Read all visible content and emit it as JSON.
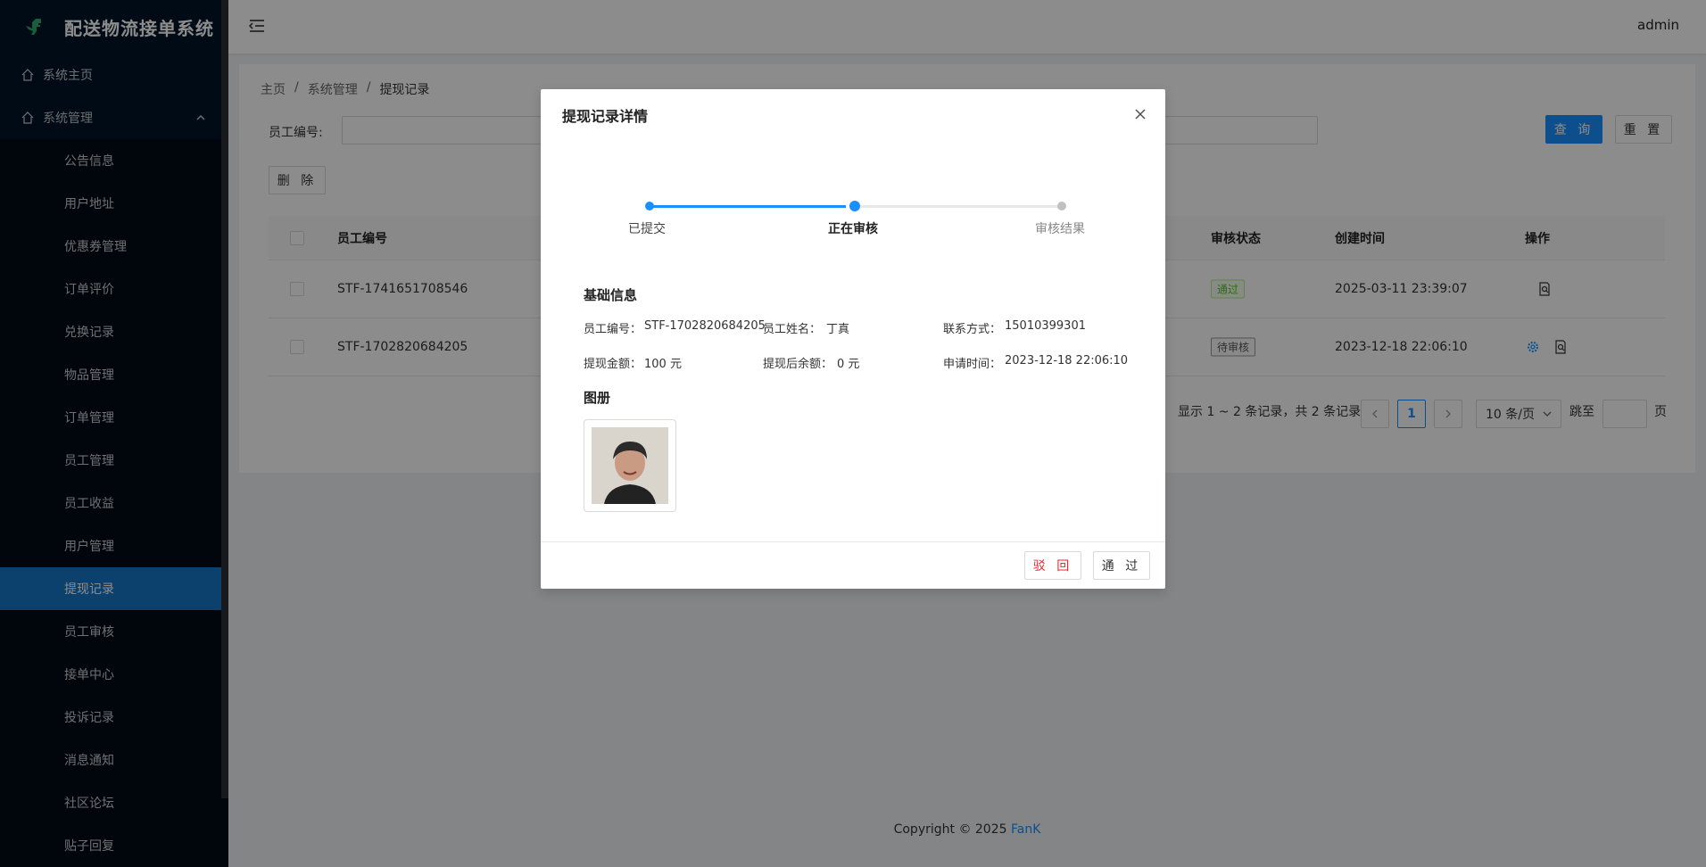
{
  "app": {
    "title": "配送物流接单系统",
    "user": "admin"
  },
  "sidebar": {
    "home": "系统主页",
    "group": "系统管理",
    "items": [
      {
        "label": "公告信息"
      },
      {
        "label": "用户地址"
      },
      {
        "label": "优惠券管理"
      },
      {
        "label": "订单评价"
      },
      {
        "label": "兑换记录"
      },
      {
        "label": "物品管理"
      },
      {
        "label": "订单管理"
      },
      {
        "label": "员工管理"
      },
      {
        "label": "员工收益"
      },
      {
        "label": "用户管理"
      },
      {
        "label": "提现记录",
        "active": true
      },
      {
        "label": "员工审核"
      },
      {
        "label": "接单中心"
      },
      {
        "label": "投诉记录"
      },
      {
        "label": "消息通知"
      },
      {
        "label": "社区论坛"
      },
      {
        "label": "贴子回复"
      }
    ]
  },
  "breadcrumb": [
    "主页",
    "系统管理",
    "提现记录"
  ],
  "search": {
    "label": "员工编号:",
    "value": "",
    "query_btn": "查 询",
    "reset_btn": "重 置"
  },
  "toolbar": {
    "delete_btn": "删 除"
  },
  "table": {
    "headers": {
      "staff_no": "员工编号",
      "status": "审核状态",
      "created": "创建时间",
      "ops": "操作"
    },
    "rows": [
      {
        "staff_no": "STF-1741651708546",
        "status": "通过",
        "created": "2025-03-11 23:39:07"
      },
      {
        "staff_no": "STF-1702820684205",
        "status": "待审核",
        "created": "2023-12-18 22:06:10"
      }
    ]
  },
  "pagination": {
    "summary": "显示 1 ~ 2 条记录，共 2 条记录",
    "current_page": "1",
    "page_size": "10 条/页",
    "jump_label": "跳至",
    "page_unit": "页"
  },
  "footer": {
    "copyright": "Copyright © 2025 ",
    "brand": "FanK"
  },
  "modal": {
    "title": "提现记录详情",
    "steps": [
      "已提交",
      "正在审核",
      "审核结果"
    ],
    "current_step": 2,
    "basic_title": "基础信息",
    "fields": {
      "staff_no_k": "员工编号：",
      "staff_no_v": "STF-1702820684205",
      "name_k": "员工姓名：",
      "name_v": "丁真",
      "phone_k": "联系方式：",
      "phone_v": "15010399301",
      "amount_k": "提现金额：",
      "amount_v": "100 元",
      "balance_k": "提现后余额：",
      "balance_v": "0 元",
      "apply_k": "申请时间：",
      "apply_v": "2023-12-18 22:06:10"
    },
    "album_title": "图册",
    "reject_btn": "驳 回",
    "approve_btn": "通 过"
  },
  "colors": {
    "primary": "#1890ff",
    "sidebar": "#001529",
    "active": "#1677c9",
    "success": "#52c41a",
    "danger": "#f5222d"
  }
}
